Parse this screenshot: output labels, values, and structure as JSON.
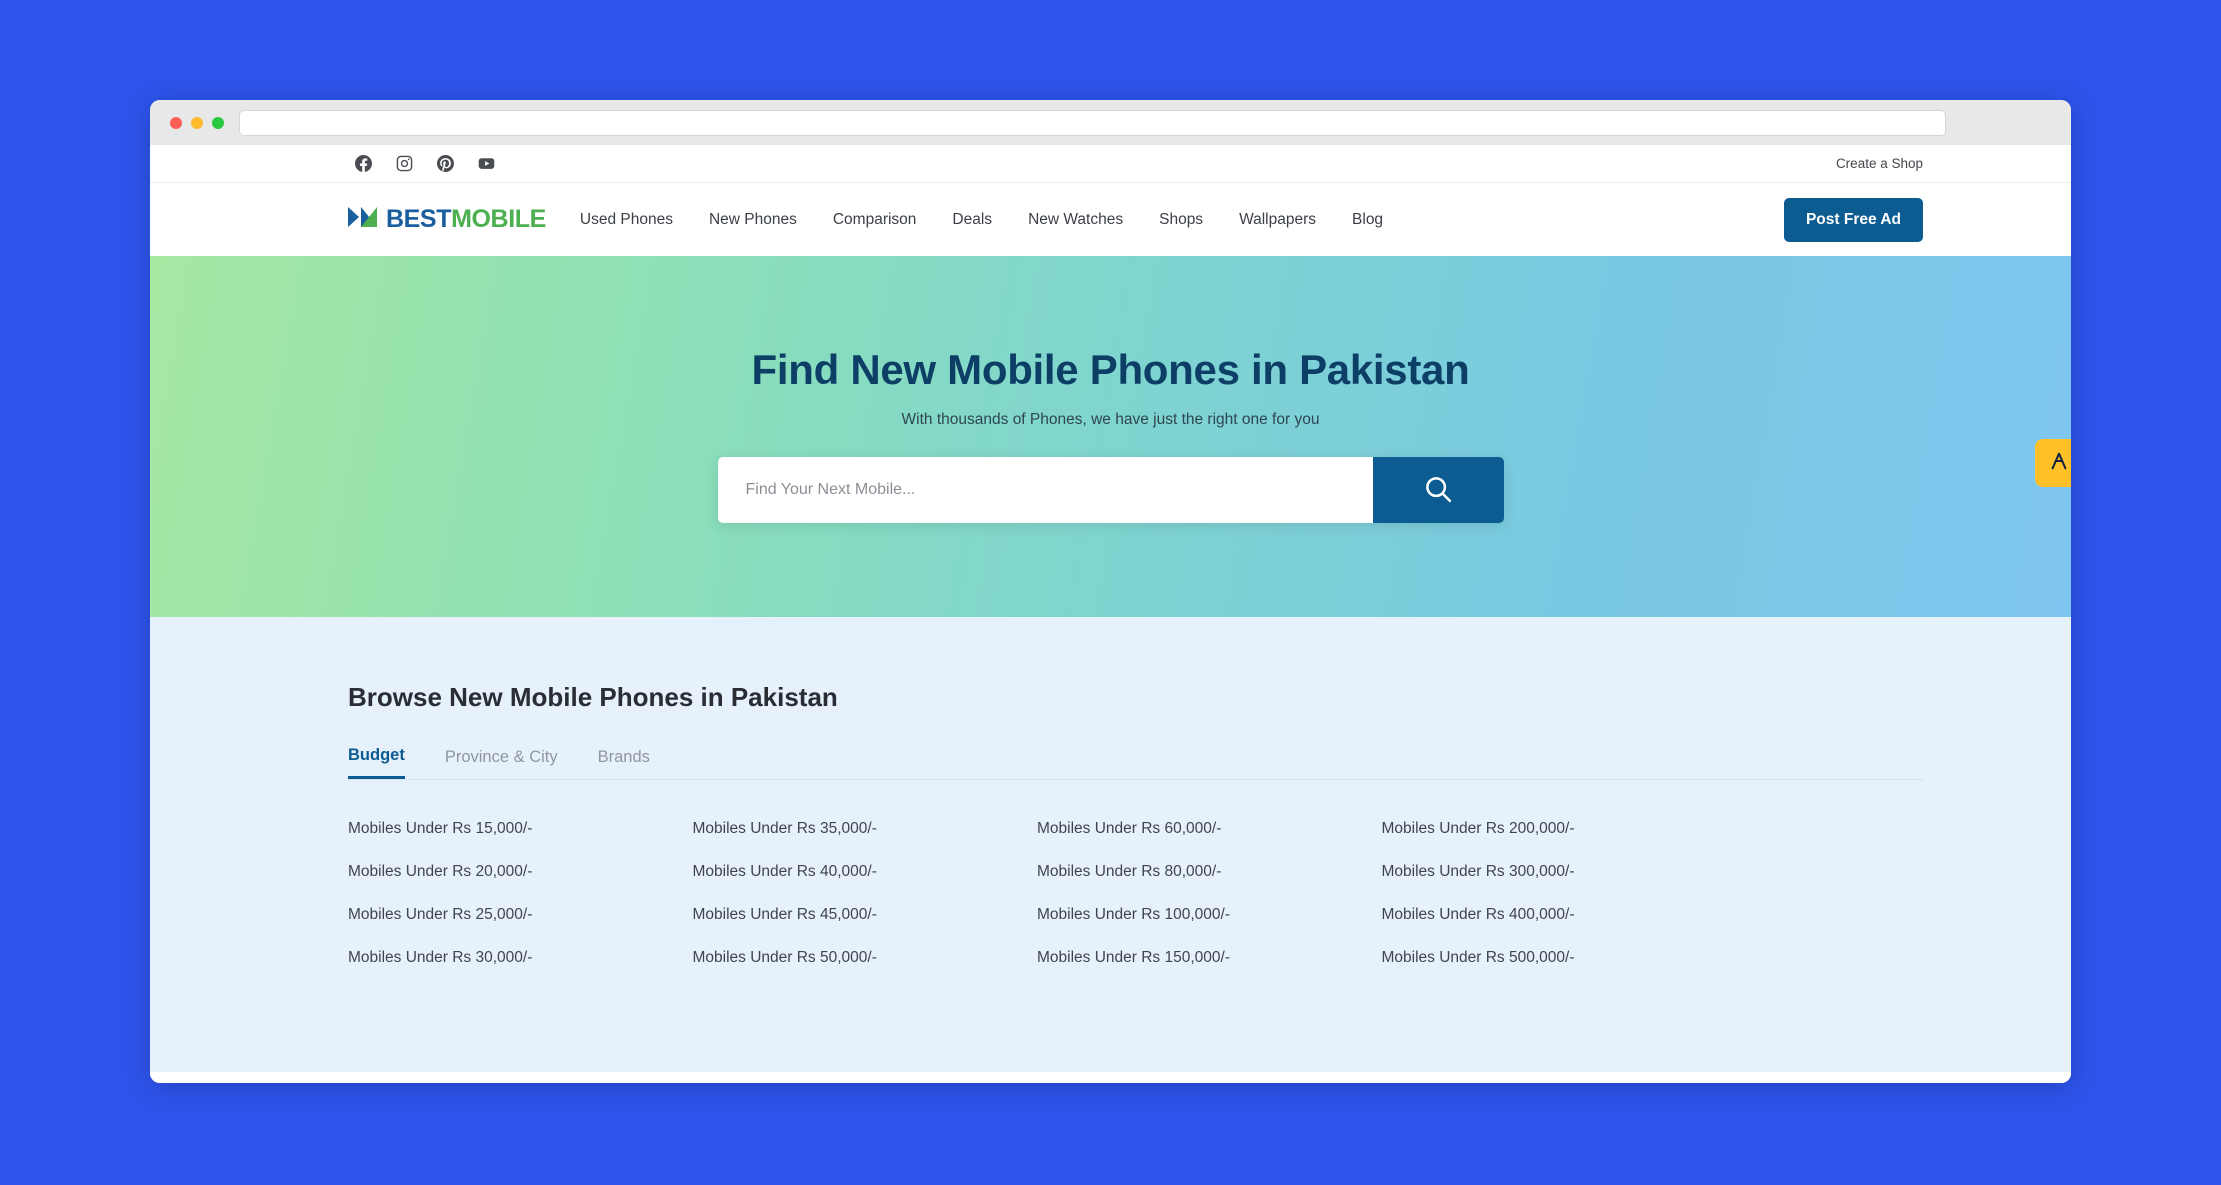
{
  "browser": {
    "url_value": "",
    "url_placeholder": "",
    "traffic_lights": [
      "close",
      "minimize",
      "maximize"
    ]
  },
  "topbar": {
    "social": [
      {
        "name": "facebook-icon",
        "label": "Facebook"
      },
      {
        "name": "instagram-icon",
        "label": "Instagram"
      },
      {
        "name": "pinterest-icon",
        "label": "Pinterest"
      },
      {
        "name": "youtube-icon",
        "label": "YouTube"
      }
    ],
    "create_shop": "Create a Shop"
  },
  "navbar": {
    "logo": {
      "best": "BEST",
      "mobile": "MOBILE"
    },
    "links": [
      {
        "label": "Used Phones"
      },
      {
        "label": "New Phones"
      },
      {
        "label": "Comparison"
      },
      {
        "label": "Deals"
      },
      {
        "label": "New Watches"
      },
      {
        "label": "Shops"
      },
      {
        "label": "Wallpapers"
      },
      {
        "label": "Blog"
      }
    ],
    "post_ad": "Post Free Ad"
  },
  "hero": {
    "title": "Find New Mobile Phones in Pakistan",
    "subtitle": "With thousands of Phones, we have just the right one for you",
    "search_placeholder": "Find Your Next Mobile...",
    "search_value": "",
    "search_icon": "search-icon",
    "gradient_from": "#a6e8a2",
    "gradient_to": "#7ec6ef"
  },
  "side_tab": {
    "icon": "chevron-up-icon",
    "color": "#ffc028"
  },
  "browse": {
    "heading": "Browse New Mobile Phones in Pakistan",
    "tabs": [
      {
        "label": "Budget",
        "active": true
      },
      {
        "label": "Province & City",
        "active": false
      },
      {
        "label": "Brands",
        "active": false
      }
    ],
    "budget_links": [
      "Mobiles Under Rs 15,000/-",
      "Mobiles Under Rs 35,000/-",
      "Mobiles Under Rs 60,000/-",
      "Mobiles Under Rs 200,000/-",
      "Mobiles Under Rs 20,000/-",
      "Mobiles Under Rs 40,000/-",
      "Mobiles Under Rs 80,000/-",
      "Mobiles Under Rs 300,000/-",
      "Mobiles Under Rs 25,000/-",
      "Mobiles Under Rs 45,000/-",
      "Mobiles Under Rs 100,000/-",
      "Mobiles Under Rs 400,000/-",
      "Mobiles Under Rs 30,000/-",
      "Mobiles Under Rs 50,000/-",
      "Mobiles Under Rs 150,000/-",
      "Mobiles Under Rs 500,000/-"
    ]
  },
  "theme": {
    "page_background": "#2d53ea",
    "accent": "#0d5c91",
    "section_background": "#e7f1fc"
  }
}
